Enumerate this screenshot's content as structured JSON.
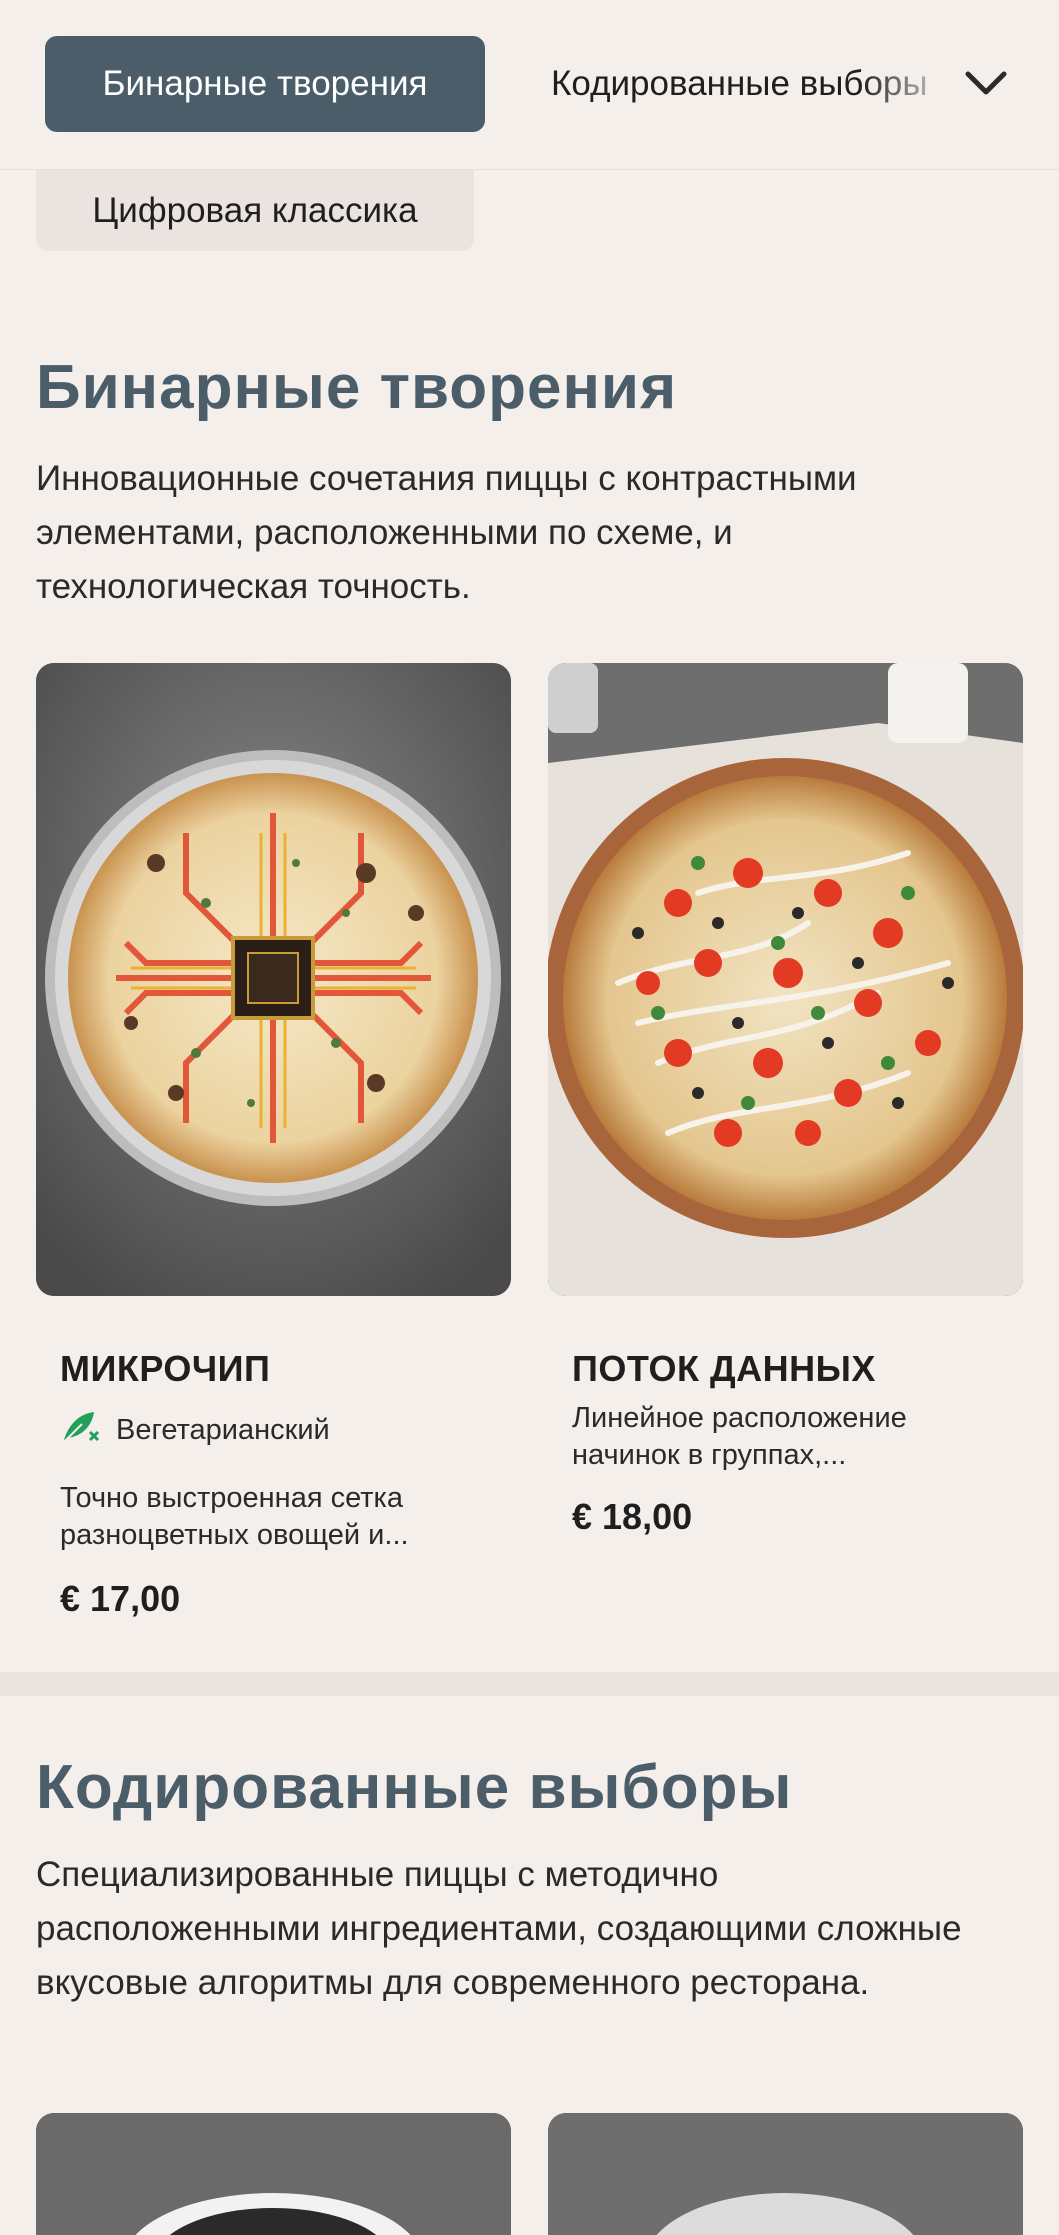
{
  "nav": {
    "tabs": [
      {
        "label": "Бинарные творения",
        "active": true
      },
      {
        "label": "Кодированные выборы",
        "active": false
      },
      {
        "label": "Цифровая классика",
        "active": false
      }
    ],
    "dropdown_icon": "chevron-down-icon"
  },
  "sections": [
    {
      "title": "Бинарные творения",
      "description": "Инновационные сочетания пиццы с контрастными элементами, расположенными по схеме, и технологическая точность.",
      "items": [
        {
          "name": "МИКРОЧИП",
          "tag": "Вегетарианский",
          "tag_icon": "vegetarian-leaf-icon",
          "description": "Точно выстроенная сетка разноцветных овощей и...",
          "price": "€ 17,00"
        },
        {
          "name": "ПОТОК ДАННЫХ",
          "description": "Линейное расположение начинок в группах,...",
          "price": "€ 18,00"
        }
      ]
    },
    {
      "title": "Кодированные выборы",
      "description": "Специализированные пиццы с методично расположенными ингредиентами, создающими сложные вкусовые алгоритмы для современного ресторана."
    }
  ],
  "colors": {
    "accent": "#4b5d69",
    "background": "#f5efec",
    "veg_icon": "#22a05a"
  }
}
